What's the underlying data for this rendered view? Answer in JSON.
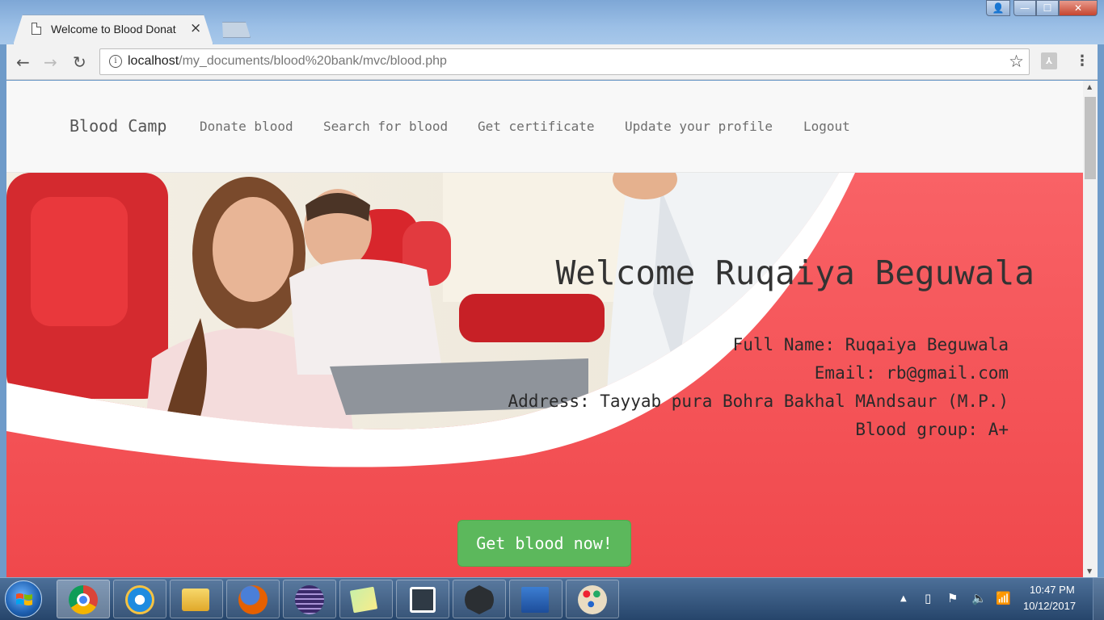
{
  "browser": {
    "tab_title": "Welcome to Blood Donat",
    "tab_close": "×",
    "url_host": "localhost",
    "url_path": "/my_documents/blood%20bank/mvc/blood.php",
    "info_glyph": "i",
    "back_glyph": "←",
    "forward_glyph": "→",
    "reload_glyph": "↻",
    "star_glyph": "☆",
    "pdf_glyph": "⅄",
    "menu_glyph": "⋮",
    "window_controls": {
      "minimize": "—",
      "maximize": "☐",
      "close": "✕",
      "user": "👤"
    }
  },
  "site": {
    "brand": "Blood Camp",
    "nav": [
      "Donate blood",
      "Search for blood",
      "Get certificate",
      "Update your profile",
      "Logout"
    ],
    "welcome": "Welcome Ruqaiya Beguwala",
    "profile": {
      "full_name": "Full Name: Ruqaiya Beguwala",
      "email": "Email: rb@gmail.com",
      "address": "Address: Tayyab pura Bohra Bakhal MAndsaur (M.P.)",
      "blood_group": "Blood group: A+"
    },
    "cta": "Get blood now!",
    "colors": {
      "hero_red": "#f25256",
      "cta_green": "#5cb85c"
    }
  },
  "taskbar": {
    "apps": [
      "chrome-icon",
      "internet-explorer-icon",
      "file-explorer-icon",
      "firefox-icon",
      "eclipse-icon",
      "sticky-notes-icon",
      "brackets-icon",
      "nox-icon",
      "word-icon",
      "paint-icon"
    ],
    "time": "10:47 PM",
    "date": "10/12/2017"
  }
}
